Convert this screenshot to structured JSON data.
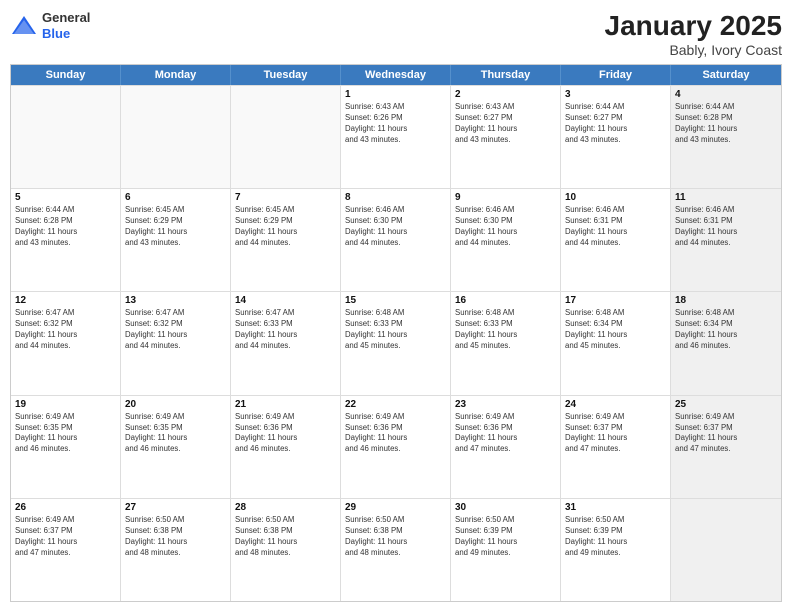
{
  "header": {
    "logo": {
      "general": "General",
      "blue": "Blue"
    },
    "title": "January 2025",
    "subtitle": "Bably, Ivory Coast"
  },
  "weekdays": [
    "Sunday",
    "Monday",
    "Tuesday",
    "Wednesday",
    "Thursday",
    "Friday",
    "Saturday"
  ],
  "rows": [
    [
      {
        "day": "",
        "info": "",
        "empty": true
      },
      {
        "day": "",
        "info": "",
        "empty": true
      },
      {
        "day": "",
        "info": "",
        "empty": true
      },
      {
        "day": "1",
        "info": "Sunrise: 6:43 AM\nSunset: 6:26 PM\nDaylight: 11 hours\nand 43 minutes."
      },
      {
        "day": "2",
        "info": "Sunrise: 6:43 AM\nSunset: 6:27 PM\nDaylight: 11 hours\nand 43 minutes."
      },
      {
        "day": "3",
        "info": "Sunrise: 6:44 AM\nSunset: 6:27 PM\nDaylight: 11 hours\nand 43 minutes."
      },
      {
        "day": "4",
        "info": "Sunrise: 6:44 AM\nSunset: 6:28 PM\nDaylight: 11 hours\nand 43 minutes.",
        "shaded": true
      }
    ],
    [
      {
        "day": "5",
        "info": "Sunrise: 6:44 AM\nSunset: 6:28 PM\nDaylight: 11 hours\nand 43 minutes."
      },
      {
        "day": "6",
        "info": "Sunrise: 6:45 AM\nSunset: 6:29 PM\nDaylight: 11 hours\nand 43 minutes."
      },
      {
        "day": "7",
        "info": "Sunrise: 6:45 AM\nSunset: 6:29 PM\nDaylight: 11 hours\nand 44 minutes."
      },
      {
        "day": "8",
        "info": "Sunrise: 6:46 AM\nSunset: 6:30 PM\nDaylight: 11 hours\nand 44 minutes."
      },
      {
        "day": "9",
        "info": "Sunrise: 6:46 AM\nSunset: 6:30 PM\nDaylight: 11 hours\nand 44 minutes."
      },
      {
        "day": "10",
        "info": "Sunrise: 6:46 AM\nSunset: 6:31 PM\nDaylight: 11 hours\nand 44 minutes."
      },
      {
        "day": "11",
        "info": "Sunrise: 6:46 AM\nSunset: 6:31 PM\nDaylight: 11 hours\nand 44 minutes.",
        "shaded": true
      }
    ],
    [
      {
        "day": "12",
        "info": "Sunrise: 6:47 AM\nSunset: 6:32 PM\nDaylight: 11 hours\nand 44 minutes."
      },
      {
        "day": "13",
        "info": "Sunrise: 6:47 AM\nSunset: 6:32 PM\nDaylight: 11 hours\nand 44 minutes."
      },
      {
        "day": "14",
        "info": "Sunrise: 6:47 AM\nSunset: 6:33 PM\nDaylight: 11 hours\nand 44 minutes."
      },
      {
        "day": "15",
        "info": "Sunrise: 6:48 AM\nSunset: 6:33 PM\nDaylight: 11 hours\nand 45 minutes."
      },
      {
        "day": "16",
        "info": "Sunrise: 6:48 AM\nSunset: 6:33 PM\nDaylight: 11 hours\nand 45 minutes."
      },
      {
        "day": "17",
        "info": "Sunrise: 6:48 AM\nSunset: 6:34 PM\nDaylight: 11 hours\nand 45 minutes."
      },
      {
        "day": "18",
        "info": "Sunrise: 6:48 AM\nSunset: 6:34 PM\nDaylight: 11 hours\nand 46 minutes.",
        "shaded": true
      }
    ],
    [
      {
        "day": "19",
        "info": "Sunrise: 6:49 AM\nSunset: 6:35 PM\nDaylight: 11 hours\nand 46 minutes."
      },
      {
        "day": "20",
        "info": "Sunrise: 6:49 AM\nSunset: 6:35 PM\nDaylight: 11 hours\nand 46 minutes."
      },
      {
        "day": "21",
        "info": "Sunrise: 6:49 AM\nSunset: 6:36 PM\nDaylight: 11 hours\nand 46 minutes."
      },
      {
        "day": "22",
        "info": "Sunrise: 6:49 AM\nSunset: 6:36 PM\nDaylight: 11 hours\nand 46 minutes."
      },
      {
        "day": "23",
        "info": "Sunrise: 6:49 AM\nSunset: 6:36 PM\nDaylight: 11 hours\nand 47 minutes."
      },
      {
        "day": "24",
        "info": "Sunrise: 6:49 AM\nSunset: 6:37 PM\nDaylight: 11 hours\nand 47 minutes."
      },
      {
        "day": "25",
        "info": "Sunrise: 6:49 AM\nSunset: 6:37 PM\nDaylight: 11 hours\nand 47 minutes.",
        "shaded": true
      }
    ],
    [
      {
        "day": "26",
        "info": "Sunrise: 6:49 AM\nSunset: 6:37 PM\nDaylight: 11 hours\nand 47 minutes."
      },
      {
        "day": "27",
        "info": "Sunrise: 6:50 AM\nSunset: 6:38 PM\nDaylight: 11 hours\nand 48 minutes."
      },
      {
        "day": "28",
        "info": "Sunrise: 6:50 AM\nSunset: 6:38 PM\nDaylight: 11 hours\nand 48 minutes."
      },
      {
        "day": "29",
        "info": "Sunrise: 6:50 AM\nSunset: 6:38 PM\nDaylight: 11 hours\nand 48 minutes."
      },
      {
        "day": "30",
        "info": "Sunrise: 6:50 AM\nSunset: 6:39 PM\nDaylight: 11 hours\nand 49 minutes."
      },
      {
        "day": "31",
        "info": "Sunrise: 6:50 AM\nSunset: 6:39 PM\nDaylight: 11 hours\nand 49 minutes."
      },
      {
        "day": "",
        "info": "",
        "empty": true,
        "shaded": true
      }
    ]
  ]
}
